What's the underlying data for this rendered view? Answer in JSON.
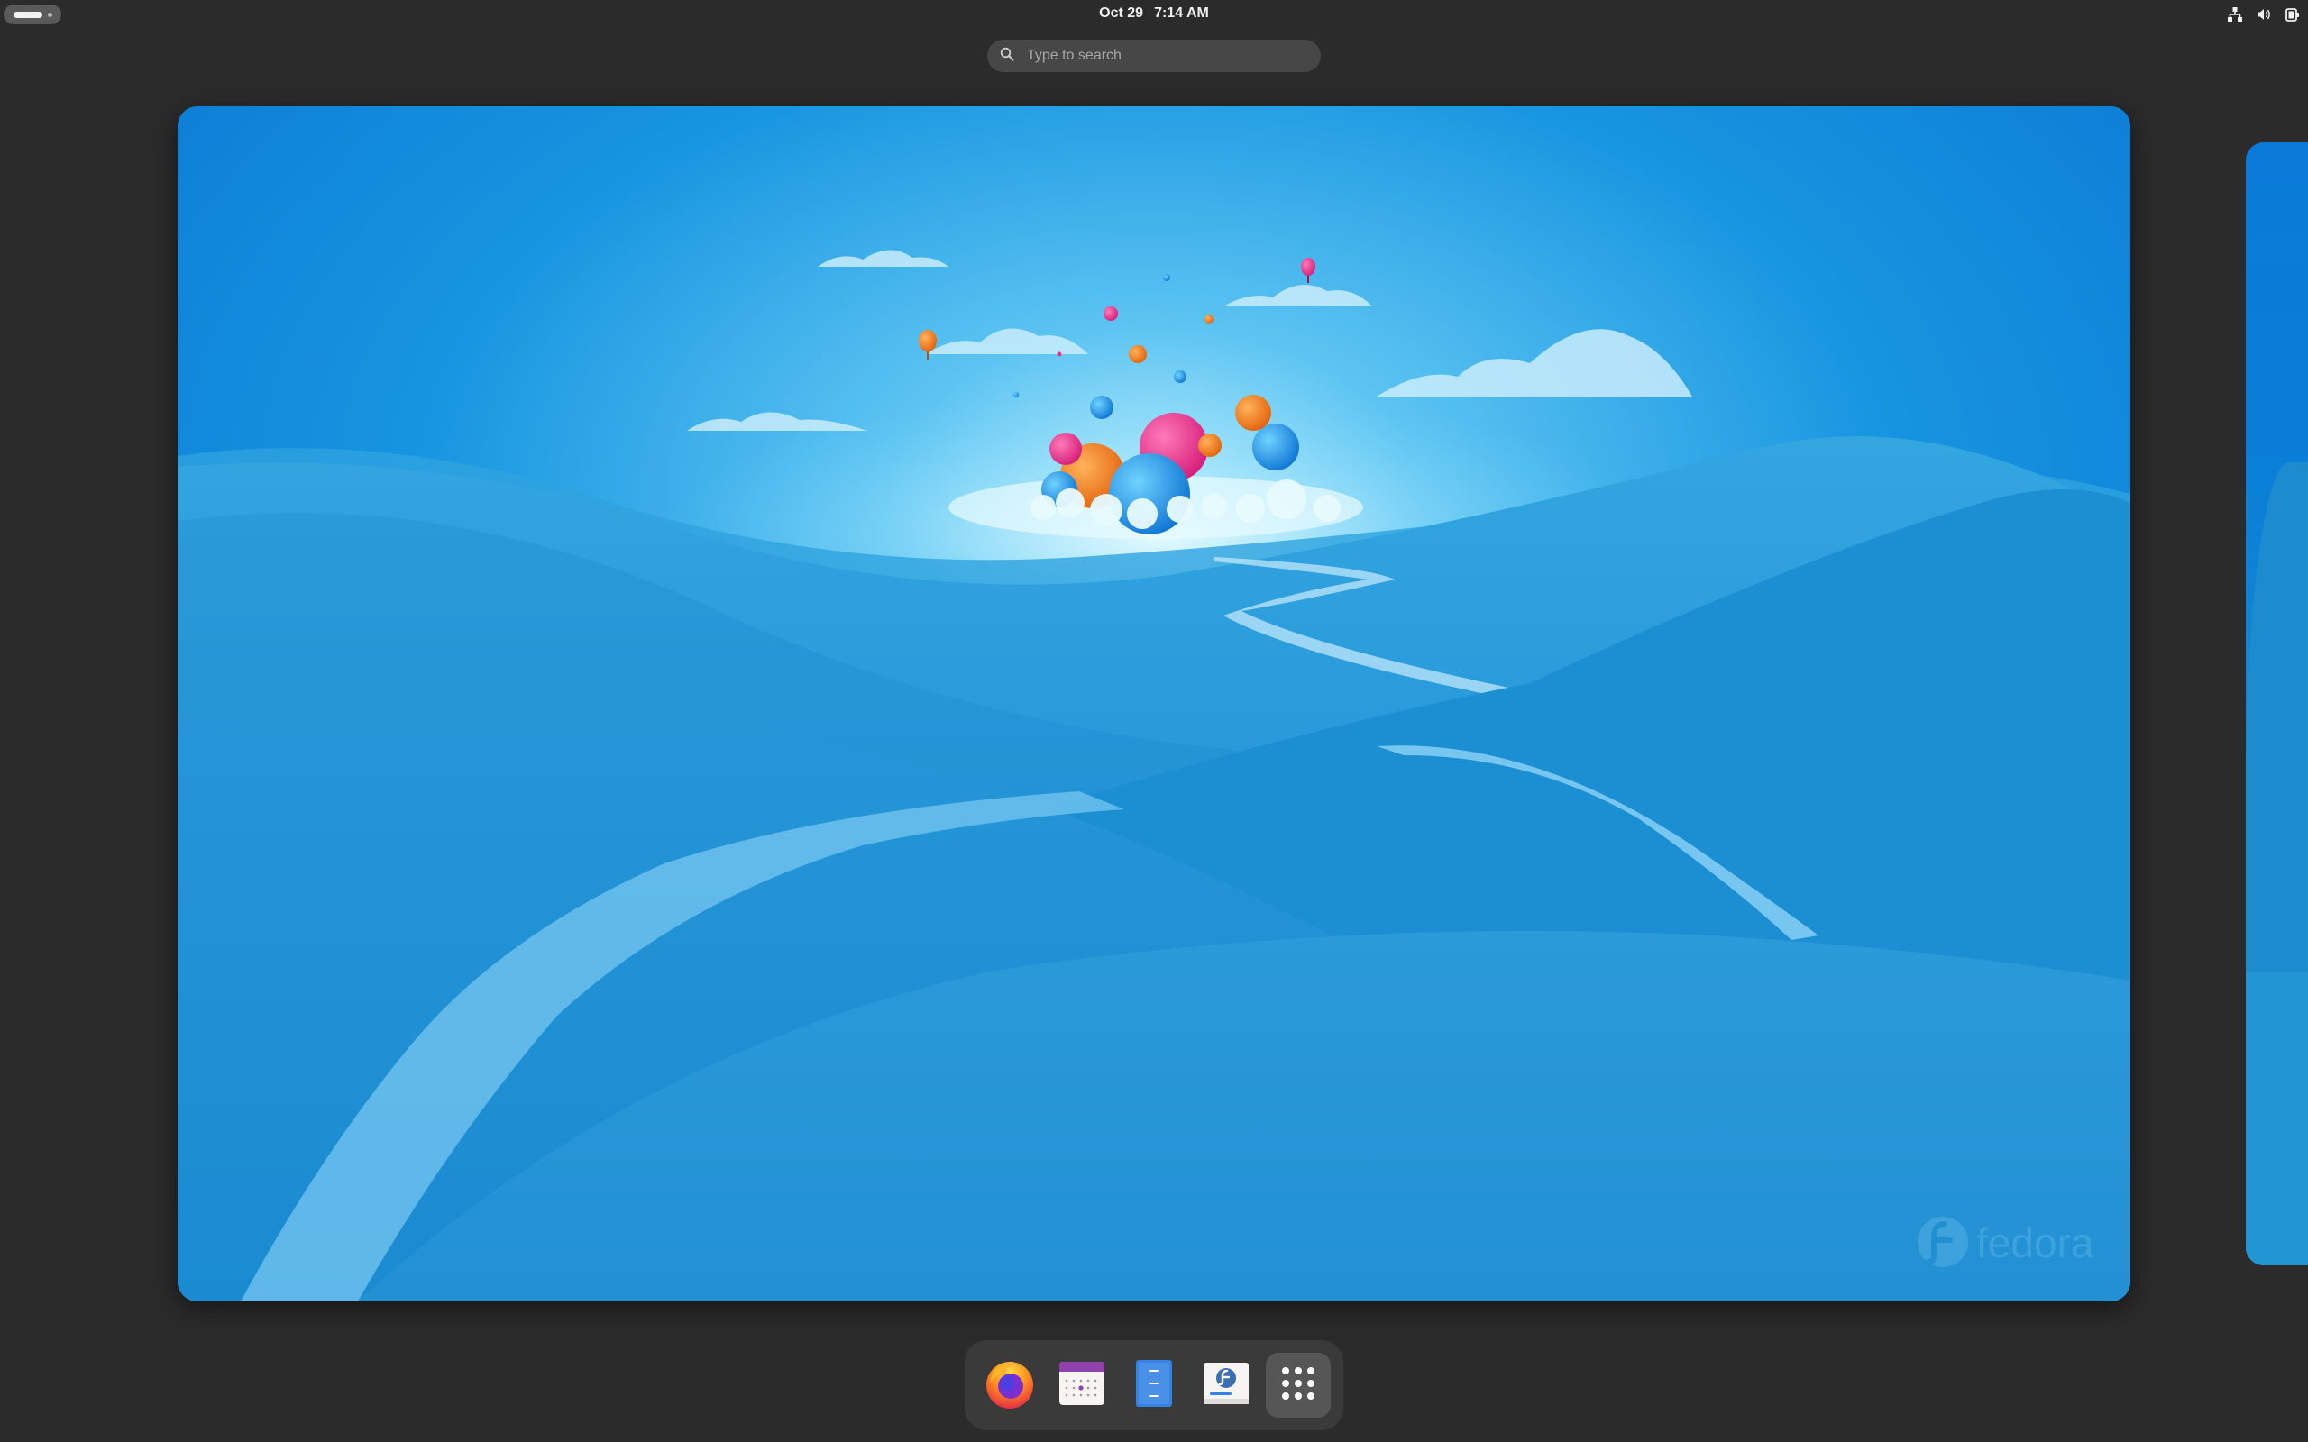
{
  "topbar": {
    "date": "Oct 29",
    "time": "7:14 AM",
    "tray_icons": [
      "network-icon",
      "volume-icon",
      "power-icon"
    ]
  },
  "search": {
    "placeholder": "Type to search"
  },
  "wallpaper": {
    "watermark": "fedora"
  },
  "dock": {
    "apps": [
      {
        "name": "Firefox",
        "icon": "firefox-icon"
      },
      {
        "name": "Calendar",
        "icon": "calendar-icon"
      },
      {
        "name": "Text Editor",
        "icon": "text-editor-icon"
      },
      {
        "name": "Software",
        "icon": "software-icon"
      },
      {
        "name": "Show Apps",
        "icon": "app-grid-icon"
      }
    ]
  },
  "colors": {
    "panel": "#2b2b2b",
    "dock": "#3a3a3a",
    "sky_blue": "#0a7fd8",
    "fedora_blue": "#3c6eb4"
  }
}
